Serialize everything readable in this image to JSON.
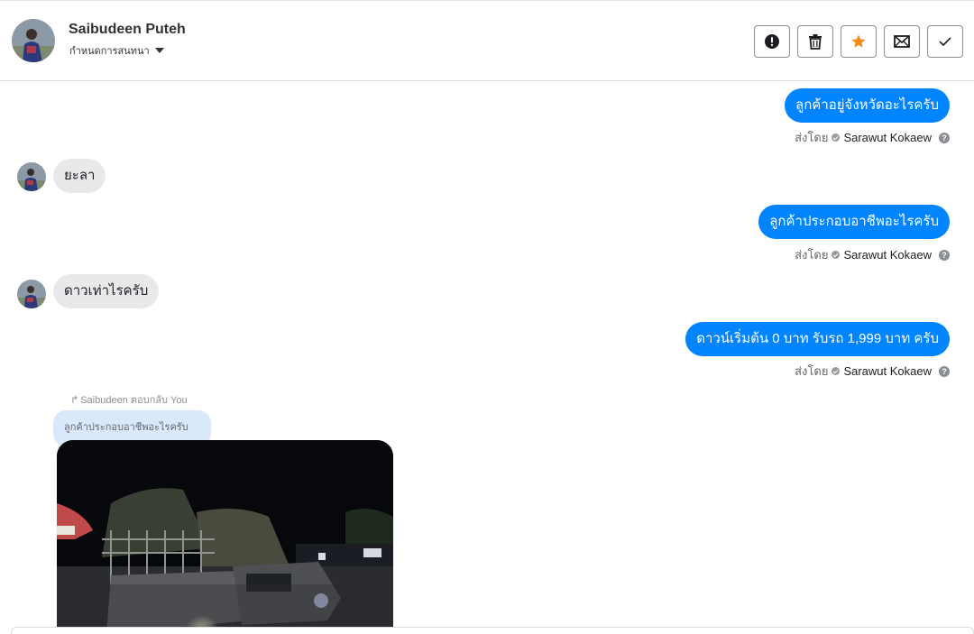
{
  "header": {
    "contact_name": "Saibudeen Puteh",
    "conversation_setting": "กำหนดการสนทนา",
    "toolbar": [
      {
        "name": "report-button",
        "icon": "alert-circle-icon"
      },
      {
        "name": "delete-button",
        "icon": "trash-icon"
      },
      {
        "name": "star-button",
        "icon": "star-icon",
        "color": "#f48a1e"
      },
      {
        "name": "mail-button",
        "icon": "envelope-icon"
      },
      {
        "name": "done-button",
        "icon": "checkmark-icon"
      }
    ]
  },
  "messages": [
    {
      "direction": "outgoing",
      "text": "ลูกค้าอยู่จังหวัดอะไรครับ",
      "sent_by_label": "ส่งโดย",
      "agent": "Sarawut Kokaew"
    },
    {
      "direction": "incoming",
      "text": "ยะลา"
    },
    {
      "direction": "outgoing",
      "text": "ลูกค้าประกอบอาชีพอะไรครับ",
      "sent_by_label": "ส่งโดย",
      "agent": "Sarawut Kokaew"
    },
    {
      "direction": "incoming",
      "text": "ดาวเท่าไรครับ"
    },
    {
      "direction": "outgoing",
      "text": "ดาวน์เริ่มต้น 0 บาท รับรถ 1,999 บาท ครับ",
      "sent_by_label": "ส่งโดย",
      "agent": "Sarawut Kokaew"
    }
  ],
  "reply": {
    "note": "Saibudeen ตอบกลับ You",
    "quoted_text": "ลูกค้าประกอบอาชีพอะไรครับ"
  },
  "colors": {
    "outgoing_bubble": "#0084ff",
    "incoming_bubble": "#e9e9eb",
    "quoted_bubble": "#d9e8fb"
  }
}
